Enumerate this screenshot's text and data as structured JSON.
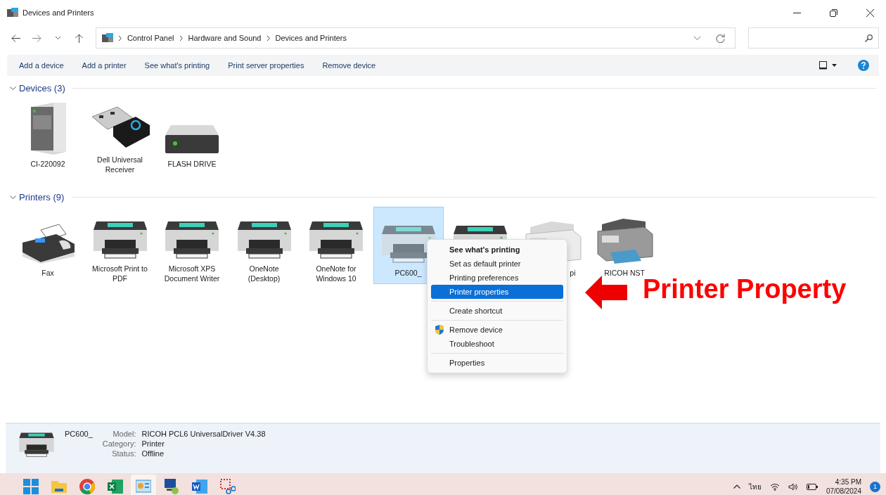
{
  "window": {
    "title": "Devices and Printers"
  },
  "address_bar": {
    "breadcrumbs": [
      "Control Panel",
      "Hardware and Sound",
      "Devices and Printers"
    ]
  },
  "command_bar": {
    "commands": [
      "Add a device",
      "Add a printer",
      "See what's printing",
      "Print server properties",
      "Remove device"
    ]
  },
  "groups": [
    {
      "title": "Devices (3)",
      "expanded": true,
      "items": [
        {
          "kind": "server",
          "label": "CI-220092",
          "selected": false
        },
        {
          "kind": "usb-receiver",
          "label": "Dell Universal Receiver",
          "selected": false
        },
        {
          "kind": "drive",
          "label": "FLASH DRIVE",
          "selected": false
        }
      ]
    },
    {
      "title": "Printers (9)",
      "expanded": true,
      "items": [
        {
          "kind": "fax",
          "label": "Fax",
          "selected": false
        },
        {
          "kind": "printer",
          "label": "Microsoft Print to PDF",
          "selected": false
        },
        {
          "kind": "printer",
          "label": "Microsoft XPS Document Writer",
          "selected": false
        },
        {
          "kind": "printer",
          "label": "OneNote (Desktop)",
          "selected": false
        },
        {
          "kind": "printer",
          "label": "OneNote for Windows 10",
          "selected": false
        },
        {
          "kind": "printer",
          "label": "PC600_",
          "selected": true
        },
        {
          "kind": "printer",
          "selected": false
        },
        {
          "kind": "mfp",
          "label": "pi",
          "label_clipped": true,
          "selected": false
        },
        {
          "kind": "mfp-dark",
          "label": "RICOH NST",
          "selected": false
        }
      ]
    }
  ],
  "context_menu": {
    "items": [
      {
        "kind": "item",
        "label": "See what's printing",
        "bold": true,
        "selected": false
      },
      {
        "kind": "item",
        "label": "Set as default printer",
        "bold": false,
        "selected": false
      },
      {
        "kind": "item",
        "label": "Printing preferences",
        "bold": false,
        "selected": false
      },
      {
        "kind": "item",
        "label": "Printer properties",
        "bold": false,
        "selected": true
      },
      {
        "kind": "separator"
      },
      {
        "kind": "item",
        "label": "Create shortcut",
        "bold": false,
        "selected": false
      },
      {
        "kind": "separator"
      },
      {
        "kind": "item",
        "label": "Remove device",
        "bold": false,
        "selected": false,
        "shield": true
      },
      {
        "kind": "item",
        "label": "Troubleshoot",
        "bold": false,
        "selected": false
      },
      {
        "kind": "separator"
      },
      {
        "kind": "item",
        "label": "Properties",
        "bold": false,
        "selected": false
      }
    ]
  },
  "annotation": {
    "text": "Printer Property"
  },
  "details_pane": {
    "name": "PC600_",
    "fields": [
      {
        "key": "Model:",
        "value": "RICOH PCL6 UniversalDriver V4.38"
      },
      {
        "key": "Category:",
        "value": "Printer"
      },
      {
        "key": "Status:",
        "value": "Offline"
      }
    ]
  },
  "taskbar": {
    "apps": [
      {
        "kind": "start",
        "active": false
      },
      {
        "kind": "folder",
        "active": false
      },
      {
        "kind": "browser",
        "active": false
      },
      {
        "kind": "spreadsheet",
        "active": false
      },
      {
        "kind": "control-panel",
        "active": true
      },
      {
        "kind": "network",
        "active": false
      },
      {
        "kind": "document",
        "active": false
      },
      {
        "kind": "snip",
        "active": false
      }
    ],
    "language": "ไทย",
    "time": "4:35 PM",
    "date": "07/08/2024",
    "notifications": "1"
  }
}
